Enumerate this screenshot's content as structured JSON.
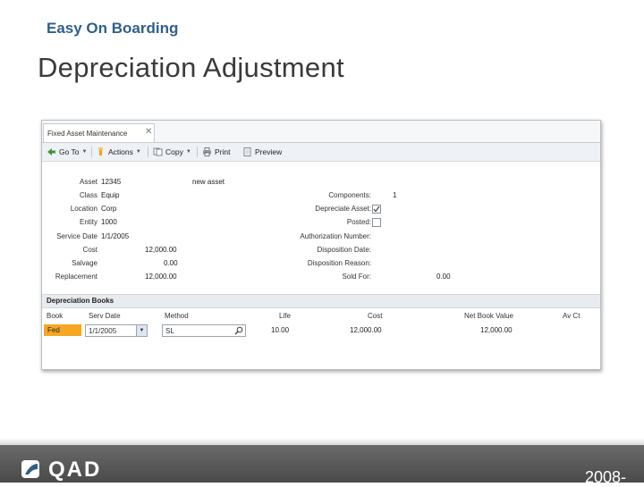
{
  "header": {
    "kicker": "Easy On Boarding",
    "title": "Depreciation Adjustment"
  },
  "window": {
    "tab_label": "Fixed Asset Maintenance"
  },
  "toolbar": {
    "goto": "Go To",
    "actions": "Actions",
    "copy": "Copy",
    "print": "Print",
    "preview": "Preview"
  },
  "form": {
    "asset_label": "Asset",
    "asset_value": "12345",
    "asset_desc": "new asset",
    "class_label": "Class",
    "class_value": "Equip",
    "location_label": "Location",
    "location_value": "Corp",
    "entity_label": "Entity",
    "entity_value": "1000",
    "service_date_label": "Service Date",
    "service_date_value": "1/1/2005",
    "cost_label": "Cost",
    "cost_value": "12,000.00",
    "salvage_label": "Salvage",
    "salvage_value": "0.00",
    "replacement_label": "Replacement",
    "replacement_value": "12,000.00",
    "components_label": "Components:",
    "components_value": "1",
    "depreciate_label": "Depreciate Asset:",
    "posted_label": "Posted:",
    "auth_label": "Authorization Number:",
    "disposition_date_label": "Disposition Date:",
    "disposition_reason_label": "Disposition Reason:",
    "sold_for_label": "Sold For:",
    "sold_for_value": "0.00"
  },
  "depreciation_books": {
    "section_title": "Depreciation Books",
    "columns": {
      "book": "Book",
      "serv_date": "Serv Date",
      "method": "Method",
      "life": "Life",
      "cost": "Cost",
      "nbv": "Net Book Value",
      "acct": "Av Ct"
    },
    "row": {
      "book": "Fed",
      "serv_date": "1/1/2005",
      "method": "SL",
      "life": "10.00",
      "cost": "12,000.00",
      "nbv": "12,000.00"
    }
  },
  "footer": {
    "logo": "QAD",
    "year": "2008-"
  },
  "colors": {
    "accent": "#2f5f8a",
    "selected_row": "#f6a623",
    "footer": "#555555"
  }
}
